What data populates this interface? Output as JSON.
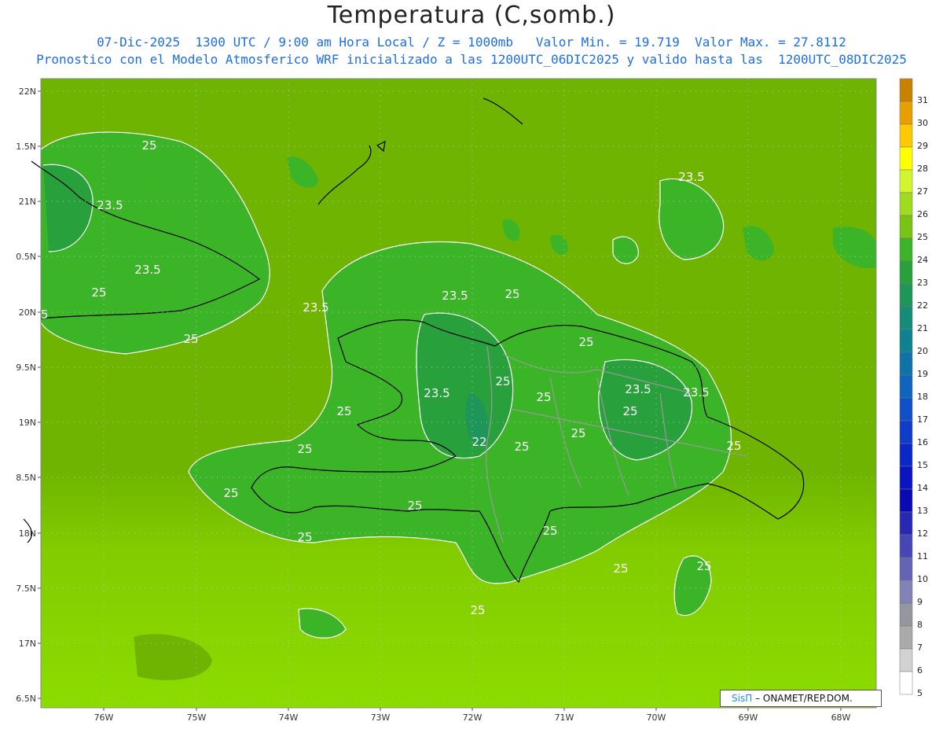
{
  "header": {
    "title": "Temperatura (C,somb.)",
    "line1": "07-Dic-2025  1300 UTC / 9:00 am Hora Local / Z = 1000mb   Valor Min. = 19.719  Valor Max. = 27.8112",
    "line2": "Pronostico con el Modelo Atmosferico WRF inicializado a las 1200UTC_06DIC2025 y valido hasta las  1200UTC_08DIC2025"
  },
  "axes": {
    "lat_labels": [
      "22N",
      "1.5N",
      "21N",
      "0.5N",
      "20N",
      "9.5N",
      "19N",
      "8.5N",
      "18N",
      "7.5N",
      "17N",
      "6.5N"
    ],
    "lon_labels": [
      "76W",
      "75W",
      "74W",
      "73W",
      "72W",
      "71W",
      "70W",
      "69W",
      "68W"
    ]
  },
  "colorbar": {
    "labels": [
      "31",
      "30",
      "29",
      "28",
      "27",
      "26",
      "25",
      "24",
      "23",
      "22",
      "21",
      "20",
      "19",
      "18",
      "17",
      "16",
      "15",
      "14",
      "13",
      "12",
      "11",
      "10",
      "9",
      "8",
      "7",
      "6",
      "5"
    ],
    "colors": [
      "#c88200",
      "#e6a000",
      "#ffc800",
      "#ffff00",
      "#d2f52d",
      "#a0dc1e",
      "#78c314",
      "#3cb428",
      "#28a03c",
      "#1e965a",
      "#148c78",
      "#0f8291",
      "#0f73aa",
      "#0f64be",
      "#0f50c8",
      "#0f3cc8",
      "#0a28c8",
      "#0a14c3",
      "#0a0ab4",
      "#2828b4",
      "#4646b4",
      "#6464b4",
      "#8282b4",
      "#9696a0",
      "#aaaaaa",
      "#d2d2d2",
      "#ffffff"
    ]
  },
  "contour_labels": [
    "25",
    "23.5",
    "23.5",
    "23.5",
    "25",
    "25",
    "25",
    "23.5",
    "25",
    "23.5",
    "25",
    "23.5",
    "25",
    "23.5",
    "23.5",
    "25",
    "22",
    "25",
    "25",
    "25",
    "25",
    "25",
    "25",
    "25",
    "25",
    "25",
    "25",
    "25",
    "25",
    "25",
    "25",
    "25"
  ],
  "credit": {
    "brand": "SisΠ",
    "text": "– ONAMET/REP.DOM."
  },
  "colors": {
    "sea_low": "#8cdc00",
    "sea_mid": "#6eb400",
    "land_warm": "#3ca832",
    "land_cool": "#289e50",
    "coast": "#000000",
    "border": "#999999",
    "contour": "#ffffff",
    "subtitle": "#1e6ee6"
  }
}
